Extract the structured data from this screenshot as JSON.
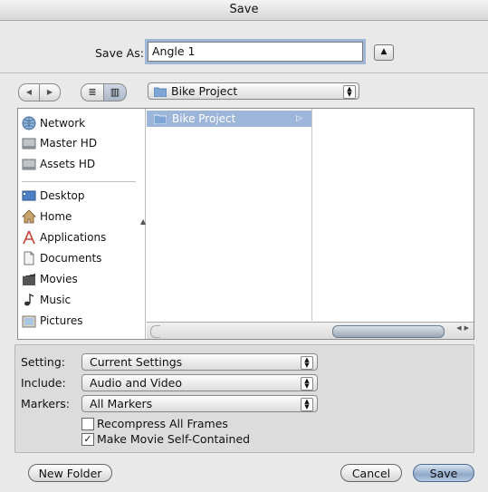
{
  "window": {
    "title": "Save"
  },
  "save_as": {
    "label": "Save As:",
    "value": "Angle 1"
  },
  "path_popup": {
    "value": "Bike Project"
  },
  "sidebar": {
    "devices": [
      "Network",
      "Master HD",
      "Assets HD"
    ],
    "places": [
      "Desktop",
      "Home",
      "Applications",
      "Documents",
      "Movies",
      "Music",
      "Pictures"
    ]
  },
  "column1": {
    "selected": "Bike Project"
  },
  "options": {
    "setting": {
      "label": "Setting:",
      "value": "Current Settings"
    },
    "include": {
      "label": "Include:",
      "value": "Audio and Video"
    },
    "markers": {
      "label": "Markers:",
      "value": "All Markers"
    },
    "recompress": {
      "label": "Recompress All Frames",
      "checked": false
    },
    "self_contained": {
      "label": "Make Movie Self-Contained",
      "checked": true
    }
  },
  "buttons": {
    "new_folder": "New Folder",
    "cancel": "Cancel",
    "save": "Save"
  }
}
